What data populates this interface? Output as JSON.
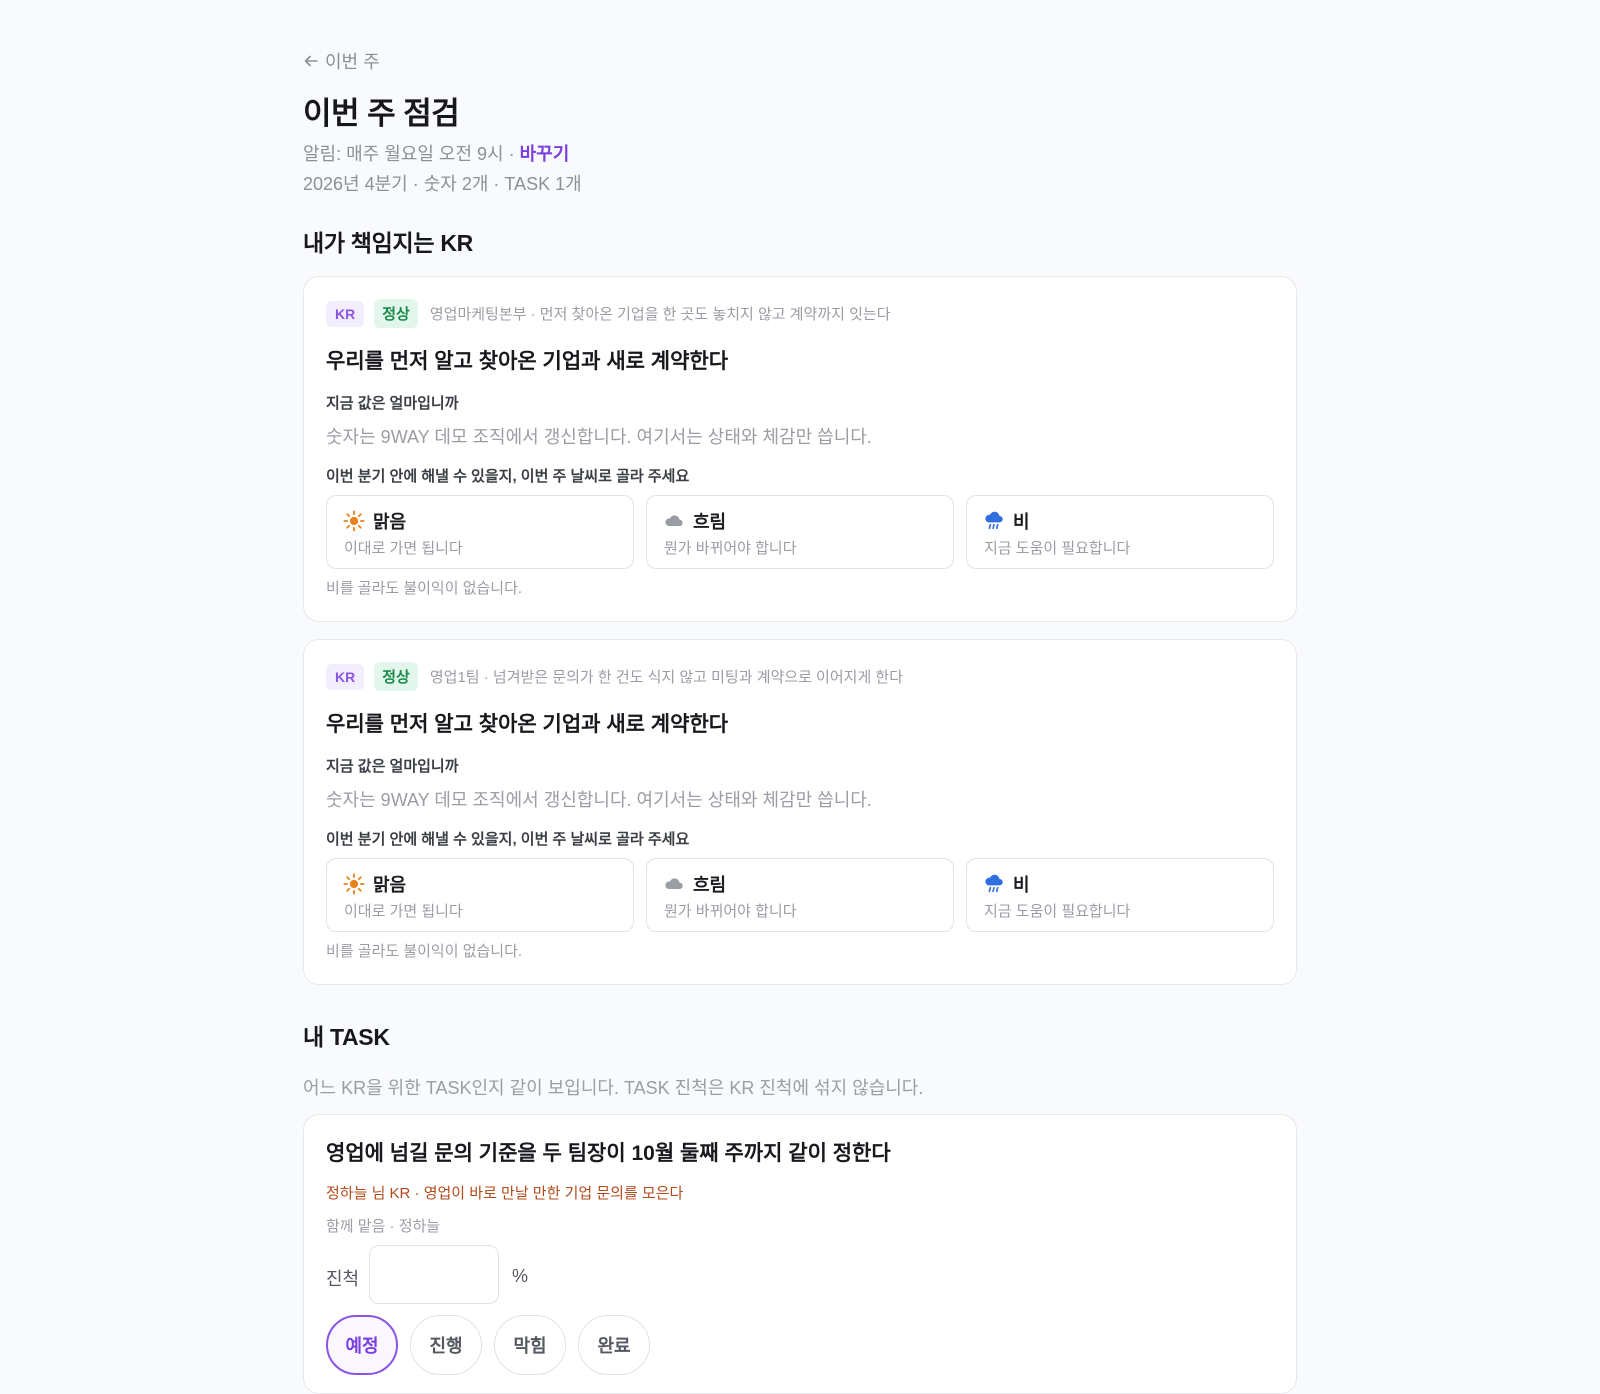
{
  "header": {
    "back_label": "이번 주",
    "title": "이번 주 점검",
    "alarm_text": "알림: 매주 월요일 오전 9시 · ",
    "alarm_change": "바꾸기",
    "summary": "2026년 4분기 · 숫자 2개 · TASK 1개"
  },
  "kr_section": {
    "title": "내가 책임지는 KR",
    "cards": [
      {
        "tag_kr": "KR",
        "tag_status": "정상",
        "meta": "영업마케팅본부 · 먼저 찾아온 기업을 한 곳도 놓치지 않고 계약까지 잇는다",
        "title": "우리를 먼저 알고 찾아온 기업과 새로 계약한다",
        "value_label": "지금 값은 얼마입니까",
        "value_desc": "숫자는 9WAY 데모 조직에서 갱신합니다. 여기서는 상태와 체감만 씁니다.",
        "weather_label": "이번 분기 안에 해낼 수 있을지, 이번 주 날씨로 골라 주세요",
        "weather_options": [
          {
            "icon": "sun-icon",
            "name": "맑음",
            "sub": "이대로 가면 됩니다"
          },
          {
            "icon": "cloud-icon",
            "name": "흐림",
            "sub": "뭔가 바뀌어야 합니다"
          },
          {
            "icon": "rain-icon",
            "name": "비",
            "sub": "지금 도움이 필요합니다"
          }
        ],
        "note": "비를 골라도 불이익이 없습니다."
      },
      {
        "tag_kr": "KR",
        "tag_status": "정상",
        "meta": "영업1팀 · 넘겨받은 문의가 한 건도 식지 않고 미팅과 계약으로 이어지게 한다",
        "title": "우리를 먼저 알고 찾아온 기업과 새로 계약한다",
        "value_label": "지금 값은 얼마입니까",
        "value_desc": "숫자는 9WAY 데모 조직에서 갱신합니다. 여기서는 상태와 체감만 씁니다.",
        "weather_label": "이번 분기 안에 해낼 수 있을지, 이번 주 날씨로 골라 주세요",
        "weather_options": [
          {
            "icon": "sun-icon",
            "name": "맑음",
            "sub": "이대로 가면 됩니다"
          },
          {
            "icon": "cloud-icon",
            "name": "흐림",
            "sub": "뭔가 바뀌어야 합니다"
          },
          {
            "icon": "rain-icon",
            "name": "비",
            "sub": "지금 도움이 필요합니다"
          }
        ],
        "note": "비를 골라도 불이익이 없습니다."
      }
    ]
  },
  "task_section": {
    "title": "내 TASK",
    "desc": "어느 KR을 위한 TASK인지 같이 보입니다. TASK 진척은 KR 진척에 섞지 않습니다.",
    "task": {
      "title": "영업에 넘길 문의 기준을 두 팀장이 10월 둘째 주까지 같이 정한다",
      "kr_link": "정하늘 님 KR · 영업이 바로 만날 만한 기업 문의를 모은다",
      "with": "함께 맡음 · 정하늘",
      "progress_label": "진척",
      "progress_value": "",
      "progress_unit": "%",
      "statuses": [
        "예정",
        "진행",
        "막힘",
        "완료"
      ],
      "active_status": "예정"
    }
  },
  "colors": {
    "accent": "#7a3fe0",
    "ok_bg": "#e3f6ec",
    "ok_text": "#1c8a4b",
    "sun": "#e8821c",
    "cloud": "#9a9da4",
    "rain": "#2f6fe0"
  }
}
